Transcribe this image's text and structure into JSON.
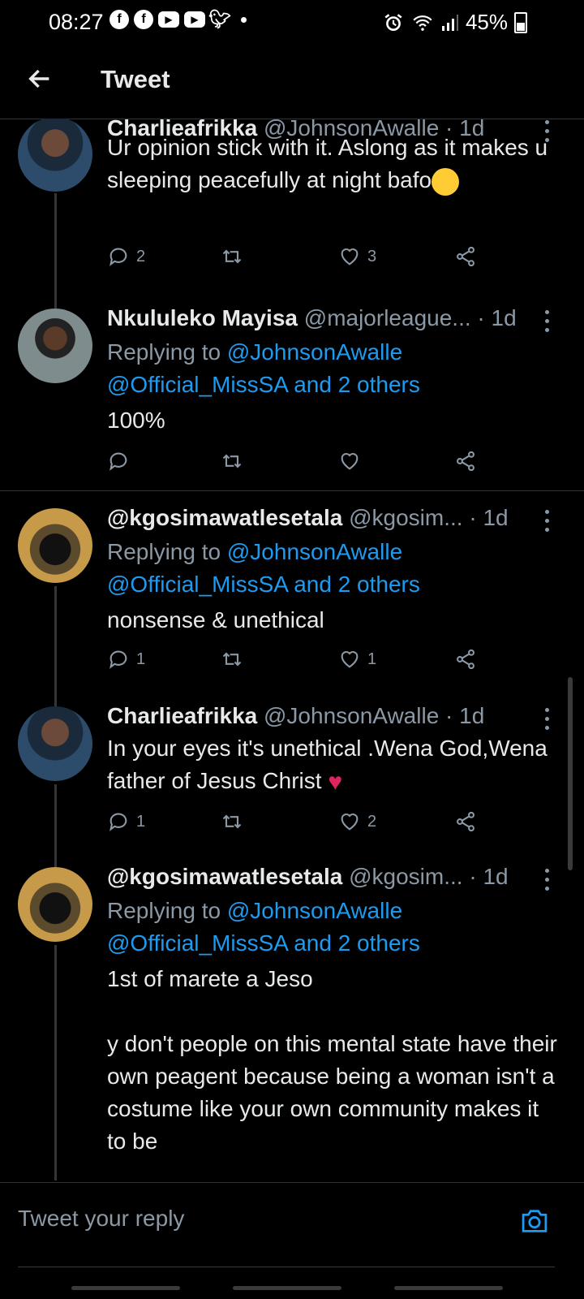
{
  "status_bar": {
    "time": "08:27",
    "notification_icons": [
      "facebook-icon",
      "facebook-icon",
      "youtube-icon",
      "youtube-icon",
      "twitter-icon"
    ],
    "battery": "45%"
  },
  "header": {
    "title": "Tweet"
  },
  "tweets": [
    {
      "name": "Charlieafrikka",
      "handle": "@JohnsonAwalle",
      "time": "· 1d",
      "text": "Ur opinion stick with it. Aslong  as it makes u sleeping peacefully at night bafo",
      "emoji": "slightly-smiling-face",
      "replies": "2",
      "retweets": "",
      "likes": "3"
    },
    {
      "name": "Nkululeko Mayisa",
      "handle": "@majorleague...",
      "time": "· 1d",
      "replying_prefix": "Replying to ",
      "replying_to": "@JohnsonAwalle",
      "replying_to_more": "@Official_MissSA and 2 others",
      "text": "100%",
      "replies": "",
      "retweets": "",
      "likes": ""
    },
    {
      "name": "@kgosimawatlesetala",
      "handle": "@kgosim...",
      "time": "· 1d",
      "replying_prefix": "Replying to ",
      "replying_to": "@JohnsonAwalle",
      "replying_to_more": "@Official_MissSA and 2 others",
      "text": "nonsense & unethical",
      "replies": "1",
      "retweets": "",
      "likes": "1"
    },
    {
      "name": "Charlieafrikka",
      "handle": "@JohnsonAwalle",
      "time": "· 1d",
      "text": "In your eyes it's unethical .Wena God,Wena father of Jesus Christ",
      "emoji": "red-heart",
      "replies": "1",
      "retweets": "",
      "likes": "2"
    },
    {
      "name": "@kgosimawatlesetala",
      "handle": "@kgosim...",
      "time": "· 1d",
      "replying_prefix": "Replying to ",
      "replying_to": "@JohnsonAwalle",
      "replying_to_more": "@Official_MissSA and 2 others",
      "text": "1st of marete a Jeso\n\ny don't people on this mental state have their own peagent because being a woman isn't a costume like your own community makes it to be"
    }
  ],
  "reply_bar": {
    "placeholder": "Tweet your reply"
  },
  "colors": {
    "background": "#000000",
    "link": "#1d9bf0",
    "secondary_text": "#8b98a5",
    "heart": "#e0245e"
  }
}
